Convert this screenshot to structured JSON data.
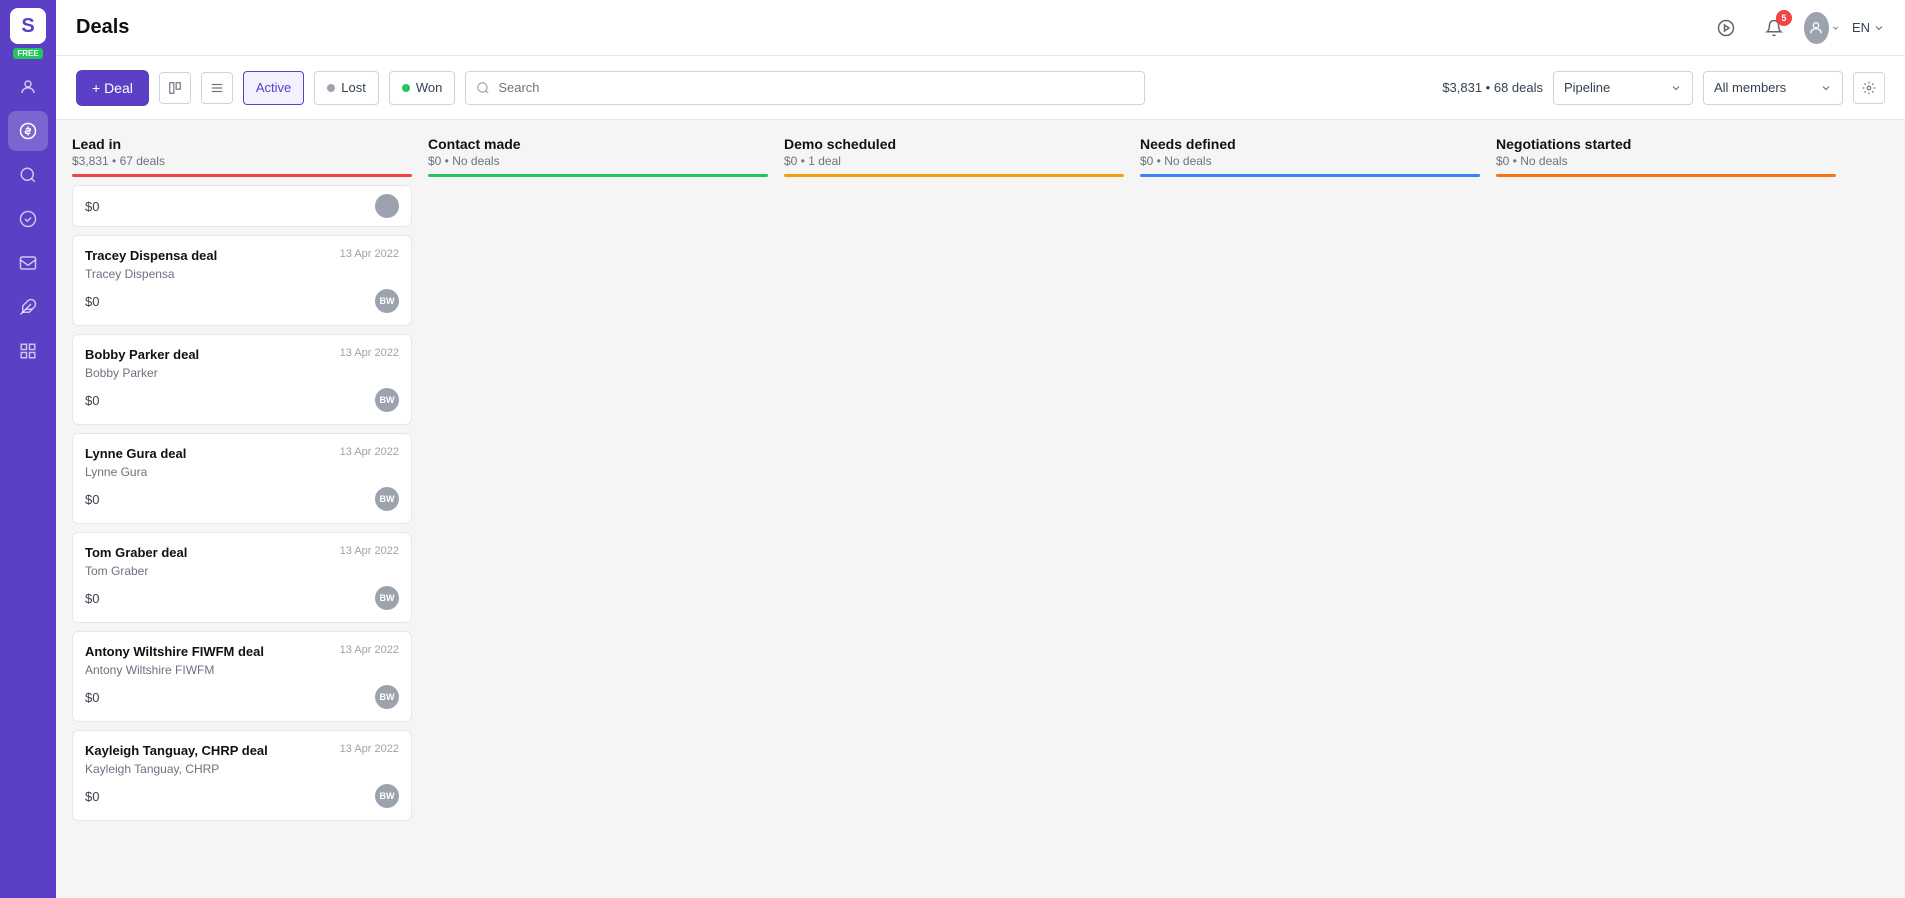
{
  "sidebar": {
    "logo": "S",
    "free_badge": "FREE",
    "icons": [
      {
        "name": "person-icon",
        "glyph": "👤",
        "active": false
      },
      {
        "name": "dollar-icon",
        "glyph": "💲",
        "active": true
      },
      {
        "name": "search-icon",
        "glyph": "🔍",
        "active": false
      },
      {
        "name": "check-circle-icon",
        "glyph": "✅",
        "active": false
      },
      {
        "name": "mail-icon",
        "glyph": "✉️",
        "active": false
      },
      {
        "name": "puzzle-icon",
        "glyph": "🧩",
        "active": false
      },
      {
        "name": "grid-icon",
        "glyph": "⊞",
        "active": false
      }
    ]
  },
  "topbar": {
    "title": "Deals",
    "lang": "EN",
    "notification_count": "5"
  },
  "toolbar": {
    "add_deal_label": "+ Deal",
    "filter_active_label": "Active",
    "filter_lost_label": "Lost",
    "filter_won_label": "Won",
    "search_placeholder": "Search",
    "deals_summary": "$3,831 • 68 deals",
    "pipeline_label": "Pipeline",
    "all_members_label": "All members"
  },
  "columns": [
    {
      "id": "lead-in",
      "title": "Lead in",
      "subtitle": "$3,831 • 67 deals",
      "bar_class": "bar-red",
      "cards": [
        {
          "name": "Tracey Dispensa deal",
          "contact": "Tracey Dispensa",
          "date": "13 Apr 2022",
          "amount": "$0",
          "avatar": "BW"
        },
        {
          "name": "Bobby Parker deal",
          "contact": "Bobby Parker",
          "date": "13 Apr 2022",
          "amount": "$0",
          "avatar": "BW"
        },
        {
          "name": "Lynne Gura deal",
          "contact": "Lynne Gura",
          "date": "13 Apr 2022",
          "amount": "$0",
          "avatar": "BW"
        },
        {
          "name": "Tom Graber deal",
          "contact": "Tom Graber",
          "date": "13 Apr 2022",
          "amount": "$0",
          "avatar": "BW"
        },
        {
          "name": "Antony Wiltshire FIWFM deal",
          "contact": "Antony Wiltshire FIWFM",
          "date": "13 Apr 2022",
          "amount": "$0",
          "avatar": "BW"
        },
        {
          "name": "Kayleigh Tanguay, CHRP deal",
          "contact": "Kayleigh Tanguay, CHRP",
          "date": "13 Apr 2022",
          "amount": "$0",
          "avatar": "BW"
        }
      ],
      "partial_card": {
        "amount": "$0"
      }
    },
    {
      "id": "contact-made",
      "title": "Contact made",
      "subtitle": "$0 • No deals",
      "bar_class": "bar-green",
      "cards": []
    },
    {
      "id": "demo-scheduled",
      "title": "Demo scheduled",
      "subtitle": "$0 • 1 deal",
      "bar_class": "bar-yellow",
      "cards": []
    },
    {
      "id": "needs-defined",
      "title": "Needs defined",
      "subtitle": "$0 • No deals",
      "bar_class": "bar-blue",
      "cards": []
    },
    {
      "id": "negotiations-started",
      "title": "Negotiations started",
      "subtitle": "$0 • No deals",
      "bar_class": "bar-orange",
      "cards": []
    }
  ]
}
